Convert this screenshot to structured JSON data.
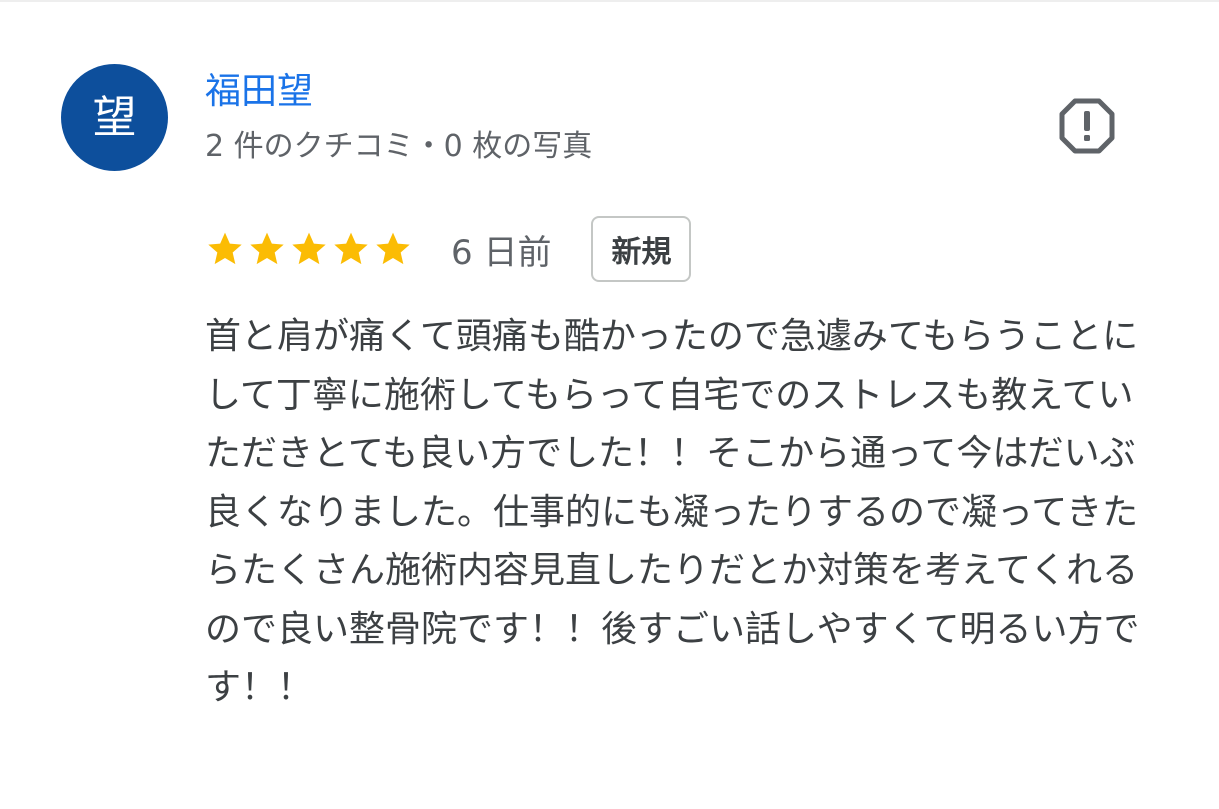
{
  "reviewer": {
    "avatar_initial": "望",
    "avatar_color": "#0d4f9c",
    "name": "福田望",
    "stats": "2 件のクチコミ・0 枚の写真"
  },
  "report": {
    "icon": "report-octagon-icon"
  },
  "review": {
    "rating": 5,
    "rating_max": 5,
    "star_color": "#fbbc04",
    "date": "6 日前",
    "badge": "新規",
    "text": "首と肩が痛くて頭痛も酷かったので急遽みてもらうことにして丁寧に施術してもらって自宅でのストレスも教えていただきとても良い方でした！！そこから通って今はだいぶ良くなりました。仕事的にも凝ったりするので凝ってきたらたくさん施術内容見直したりだとか対策を考えてくれるので良い整骨院です！！後すごい話しやすくて明るい方です！！"
  }
}
